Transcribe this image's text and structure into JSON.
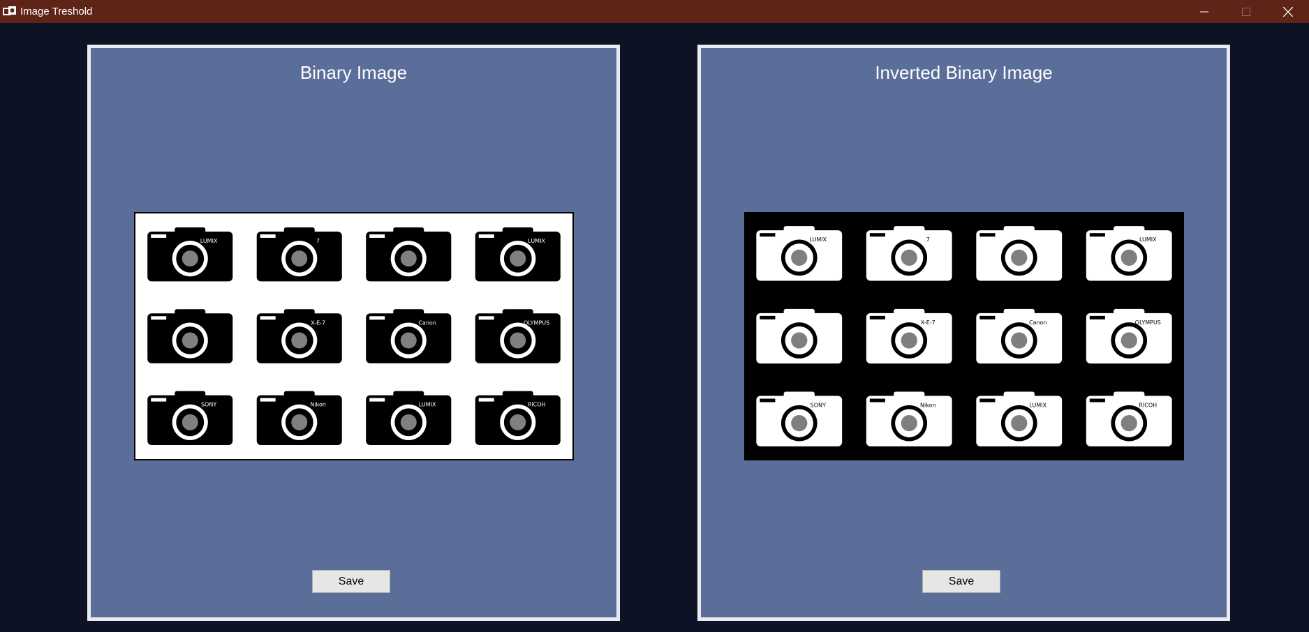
{
  "window": {
    "title": "Image Treshold",
    "icon": "image-app-icon",
    "controls": {
      "minimize": "minimize-icon",
      "maximize": "maximize-icon",
      "close": "close-icon"
    }
  },
  "left_panel": {
    "title": "Binary Image",
    "save_label": "Save"
  },
  "right_panel": {
    "title": "Inverted Binary Image",
    "save_label": "Save"
  },
  "colors": {
    "titlebar": "#5e2418",
    "background": "#0d1224",
    "panel": "#5b6d99",
    "panel_border": "#e9ebf0"
  },
  "cameras": [
    {
      "label": "LUMIX"
    },
    {
      "label": "7"
    },
    {
      "label": ""
    },
    {
      "label": "LUMIX"
    },
    {
      "label": ""
    },
    {
      "label": "X-E-7"
    },
    {
      "label": "Canon"
    },
    {
      "label": "OLYMPUS"
    },
    {
      "label": "SONY"
    },
    {
      "label": "Nikon"
    },
    {
      "label": "LUMIX"
    },
    {
      "label": "RICOH"
    }
  ]
}
